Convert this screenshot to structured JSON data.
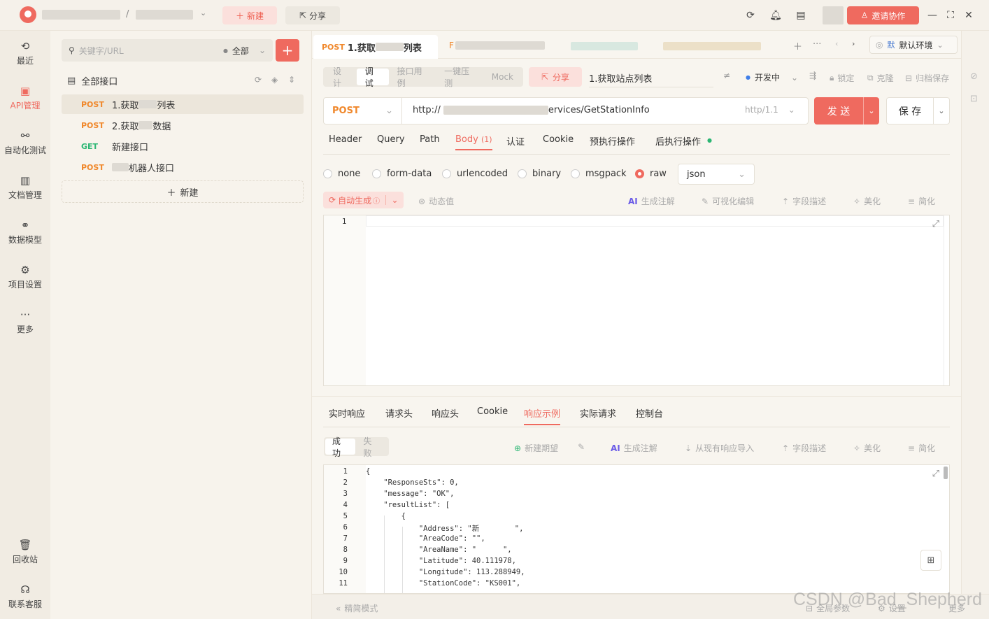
{
  "topbar": {
    "breadcrumb_sep": "/",
    "new_label": "新建",
    "share_label": "分享",
    "invite_label": "邀请协作"
  },
  "nav": [
    {
      "label": "最近"
    },
    {
      "label": "API管理"
    },
    {
      "label": "自动化测试"
    },
    {
      "label": "文档管理"
    },
    {
      "label": "数据模型"
    },
    {
      "label": "项目设置"
    },
    {
      "label": "更多"
    },
    {
      "label": "回收站"
    },
    {
      "label": "联系客服"
    }
  ],
  "tree": {
    "search_placeholder": "关键字/URL",
    "filter": "全部",
    "root_label": "全部接口",
    "items": [
      {
        "method": "POST",
        "name": "1.获取",
        "suffix": "列表"
      },
      {
        "method": "POST",
        "name": "2.获取",
        "suffix": "数据"
      },
      {
        "method": "GET",
        "name": "新建接口",
        "suffix": ""
      },
      {
        "method": "POST",
        "name": "",
        "suffix": "机器人接口"
      }
    ],
    "new_label": "新建"
  },
  "tabs": {
    "active_method": "POST",
    "active_name": "1.获取",
    "active_suffix": "列表",
    "second_prefix": "F",
    "env_badge": "默",
    "env_label": "默认环境"
  },
  "mode_tabs": [
    "设计",
    "调试",
    "接口用例",
    "一键压测",
    "Mock"
  ],
  "api": {
    "share_label": "分享",
    "title": "1.获取站点列表",
    "status": "开发中",
    "lock": "锁定",
    "clone": "克隆",
    "archive": "归档保存",
    "method": "POST",
    "url_prefix": "http://",
    "url_suffix": "ervices/GetStationInfo",
    "protocol": "http/1.1",
    "send_label": "发 送",
    "save_label": "保 存"
  },
  "req_tabs": [
    "Header",
    "Query",
    "Path",
    "Body",
    "认证",
    "Cookie",
    "预执行操作",
    "后执行操作"
  ],
  "body_count": "(1)",
  "body_types": [
    "none",
    "form-data",
    "urlencoded",
    "binary",
    "msgpack",
    "raw"
  ],
  "body_format": "json",
  "req_tools": {
    "auto": "自动生成",
    "dynamic": "动态值",
    "ai_comment": "生成注解",
    "visual": "可视化编辑",
    "field_desc": "字段描述",
    "beautify": "美化",
    "simplify": "简化"
  },
  "editor_line": "1",
  "resp_tabs": [
    "实时响应",
    "请求头",
    "响应头",
    "Cookie",
    "响应示例",
    "实际请求",
    "控制台"
  ],
  "resp_seg": [
    "成功",
    "失败"
  ],
  "resp_tools": {
    "new_expect": "新建期望",
    "ai_comment": "生成注解",
    "import": "从现有响应导入",
    "field_desc": "字段描述",
    "beautify": "美化",
    "simplify": "简化"
  },
  "code_lines": [
    {
      "n": "1",
      "t": "{"
    },
    {
      "n": "2",
      "t": "    \"ResponseSts\": 0,"
    },
    {
      "n": "3",
      "t": "    \"message\": \"OK\","
    },
    {
      "n": "4",
      "t": "    \"resultList\": ["
    },
    {
      "n": "5",
      "t": "        {"
    },
    {
      "n": "6",
      "t": "            \"Address\": \"新        \","
    },
    {
      "n": "7",
      "t": "            \"AreaCode\": \"\","
    },
    {
      "n": "8",
      "t": "            \"AreaName\": \"      \","
    },
    {
      "n": "9",
      "t": "            \"Latitude\": 40.111978,"
    },
    {
      "n": "10",
      "t": "            \"Longitude\": 113.288949,"
    },
    {
      "n": "11",
      "t": "            \"StationCode\": \"KS001\","
    }
  ],
  "bottom": {
    "compact": "精简模式",
    "global": "全局参数",
    "settings": "设置",
    "more": "更多",
    "watermark": "CSDN @Bad_Shepherd"
  }
}
